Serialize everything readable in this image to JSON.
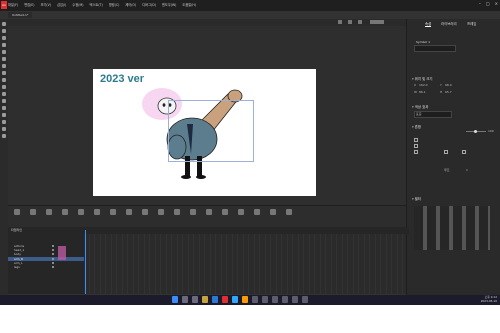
{
  "app": {
    "logo": "An"
  },
  "menu": [
    "파일(F)",
    "편집(E)",
    "보기(V)",
    "삽입(I)",
    "수정(M)",
    "텍스트(T)",
    "명령(C)",
    "제어(O)",
    "디버그(D)",
    "윈도우(W)",
    "도움말(H)"
  ],
  "document_tab": "Untitled-1*",
  "stage": {
    "title": "2023 ver"
  },
  "right_panel": {
    "tabs": [
      "속성",
      "라이브러리",
      "프레임"
    ],
    "instance_name": "Symbol 1",
    "sections": [
      "위치 및 크기",
      "색상 효과",
      "혼합",
      "필터"
    ],
    "fields": {
      "x_label": "X",
      "x_value": "162.0",
      "y_label": "Y",
      "y_value": "98.0",
      "w_label": "W",
      "w_value": "86.1",
      "h_label": "H",
      "h_value": "65.7",
      "blend": "표준",
      "tint": "100",
      "sync": "루프",
      "first": "1"
    }
  },
  "timeline": {
    "header": "타임라인",
    "layers": [
      "actions",
      "head_1",
      "body",
      "arm_R",
      "arm_L",
      "legs"
    ],
    "selected_layer_index": 3
  },
  "taskbar": {
    "time": "오후 4:12",
    "date": "2023-05-10"
  }
}
